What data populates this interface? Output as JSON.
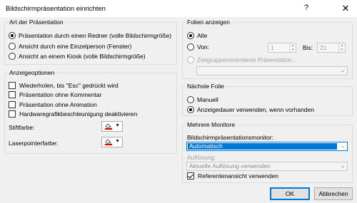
{
  "window": {
    "title": "Bildschirmpräsentation einrichten",
    "help_label": "?",
    "close_label": "✕"
  },
  "art_der_praesentation": {
    "legend": "Art der Präsentation",
    "options": [
      {
        "label": "Präsentation durch einen Redner (volle Bildschirmgröße)",
        "selected": true
      },
      {
        "label": "Ansicht durch eine Einzelperson (Fenster)",
        "selected": false
      },
      {
        "label": "Ansicht an einem Kiosk (volle Bildschirmgröße)",
        "selected": false
      }
    ]
  },
  "anzeigeoptionen": {
    "legend": "Anzeigeoptionen",
    "checkboxes": [
      {
        "label": "Wiederholen, bis \"Esc\" gedrückt wird",
        "checked": false
      },
      {
        "label": "Präsentation ohne Kommentar",
        "checked": false
      },
      {
        "label": "Präsentation ohne Animation",
        "checked": false
      },
      {
        "label": "Hardwaregrafikbeschleunigung deaktivieren",
        "checked": false
      }
    ],
    "stiftfarbe_label": "Stiftfarbe:",
    "laserpointerfarbe_label": "Laserpointerfarbe:",
    "pen_color": "#e00000",
    "laser_color": "#e00000"
  },
  "folien_anzeigen": {
    "legend": "Folien anzeigen",
    "alle_label": "Alle",
    "von_label": "Von:",
    "von_value": "1",
    "bis_label": "Bis:",
    "bis_value": "21",
    "zielgruppen_label": "Zielgruppenorientierte Präsentation..."
  },
  "naechste_folie": {
    "legend": "Nächste Folie",
    "manuell_label": "Manuell",
    "anzeigedauer_label": "Anzeigedauer verwenden, wenn vorhanden"
  },
  "mehrere_monitore": {
    "legend": "Mehrere Monitore",
    "monitor_label": "Bildschirmpräsentationsmonitor:",
    "monitor_value": "Automatisch",
    "aufloesung_label": "Auflösung:",
    "aufloesung_value": "Aktuelle Auflösung verwenden",
    "referent_label": "Referentenansicht verwenden"
  },
  "buttons": {
    "ok_label": "OK",
    "cancel_label": "Abbrechen"
  },
  "colors": {
    "accent": "#0078d7",
    "selection": "#0078d7"
  }
}
